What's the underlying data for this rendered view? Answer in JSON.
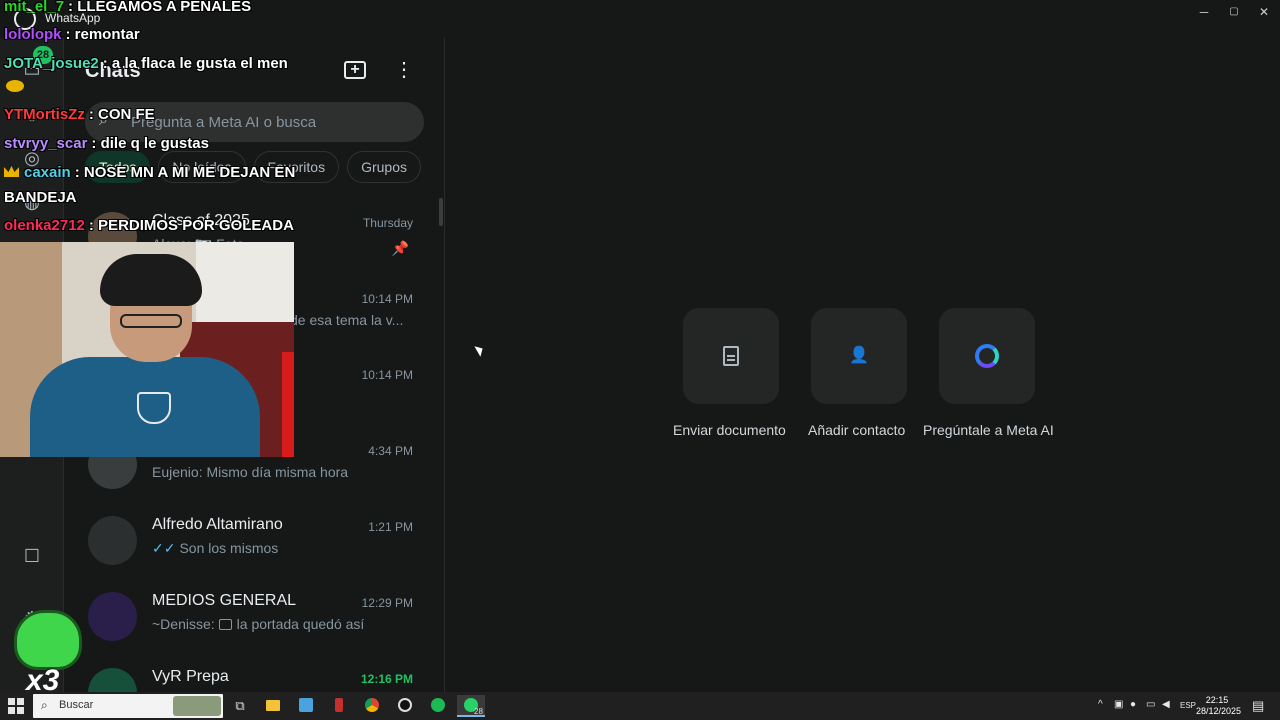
{
  "window": {
    "title": "WhatsApp",
    "controls": {
      "minimize": "─",
      "maximize": "▢",
      "close": "✕"
    }
  },
  "rail": {
    "badge": "28",
    "icons": [
      "chats-icon",
      "status-icon",
      "channels-icon",
      "communities-icon",
      "starred-icon",
      "settings-icon"
    ]
  },
  "chats_panel": {
    "title": "Chats",
    "search_placeholder": "Pregunta a Meta AI o busca",
    "filters": [
      "Todos",
      "No leídos",
      "Favoritos",
      "Grupos"
    ],
    "active_filter": "Todos"
  },
  "chats": [
    {
      "name": "Class of 2025",
      "time": "Thursday",
      "preview": "Alexa: 📷 Foto",
      "pinned": true
    },
    {
      "name": "",
      "time": "10:14 PM",
      "preview": "de esa tema la v..."
    },
    {
      "name": "",
      "time": "10:14 PM",
      "preview": ""
    },
    {
      "name": "",
      "time": "4:34 PM",
      "preview": "Eujenio: Mismo día misma hora"
    },
    {
      "name": "Alfredo Altamirano",
      "time": "1:21 PM",
      "preview": "Son los mismos",
      "ticks": "✓✓"
    },
    {
      "name": "MEDIOS GENERAL",
      "time": "12:29 PM",
      "preview_prefix": "~Denisse:",
      "preview": "la portada quedó así"
    },
    {
      "name": "VyR Prepa",
      "time": "12:16 PM",
      "preview": "",
      "unread": true
    }
  ],
  "actions": [
    {
      "label": "Enviar documento",
      "icon": "document-icon"
    },
    {
      "label": "Añadir contacto",
      "icon": "add-contact-icon"
    },
    {
      "label": "Pregúntale a Meta AI",
      "icon": "meta-ai-icon"
    }
  ],
  "stream_chat": [
    {
      "user": "mit_el_7",
      "color": "#27d927",
      "text": ": LLEGAMOS A PENALES"
    },
    {
      "user": "lololopk",
      "color": "#b44cff",
      "text": ": remontar"
    },
    {
      "user": "JOTA_josue2",
      "color": "#4fe0b8",
      "text": ": a la flaca le gusta el men"
    },
    {
      "user": "YTMortisZz",
      "color": "#ff3b3b",
      "text": ": CON FE"
    },
    {
      "user": "stvryy_scar",
      "color": "#b98cff",
      "text": ": dile q le gustas"
    },
    {
      "user": "caxain",
      "color": "#4fd1e8",
      "text": ": NOSE MN A MI ME DEJAN EN",
      "crown": true
    },
    {
      "user": "",
      "color": "#ffffff",
      "text": "BANDEJA"
    },
    {
      "user": "olenka2712",
      "color": "#ff2b5b",
      "text": ": PERDIMOS POR GOLEADA"
    }
  ],
  "sticker": {
    "text": "x3"
  },
  "taskbar": {
    "search_label": "Buscar",
    "whatsapp_badge": "28",
    "language": "ESP",
    "time": "22:15",
    "date": "28/12/2025"
  }
}
